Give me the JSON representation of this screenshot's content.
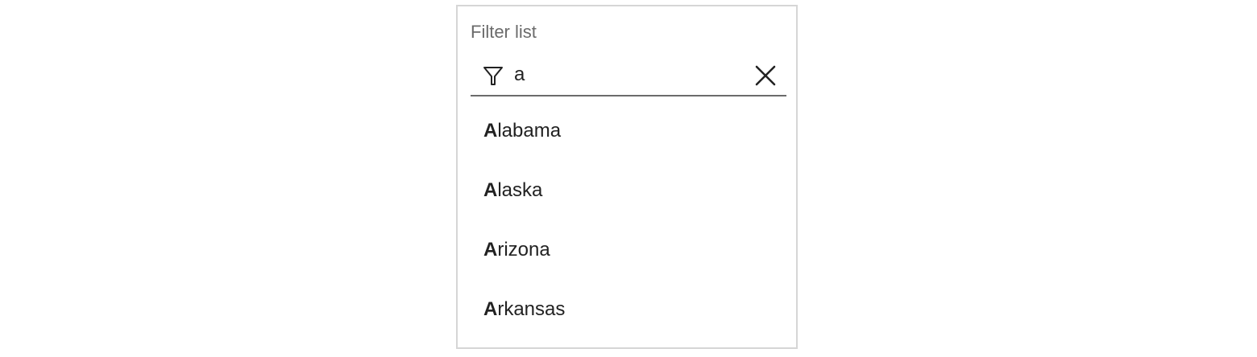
{
  "filter": {
    "label": "Filter list",
    "value": "a",
    "icon": "filter-icon",
    "clear_icon": "close-icon"
  },
  "list": {
    "items": [
      {
        "match": "A",
        "rest": "labama"
      },
      {
        "match": "A",
        "rest": "laska"
      },
      {
        "match": "A",
        "rest": "rizona"
      },
      {
        "match": "A",
        "rest": "rkansas"
      }
    ]
  },
  "colors": {
    "border": "#d6d6d6",
    "label": "#6b6b6b",
    "text": "#222222",
    "underline": "#6b6b6b"
  }
}
